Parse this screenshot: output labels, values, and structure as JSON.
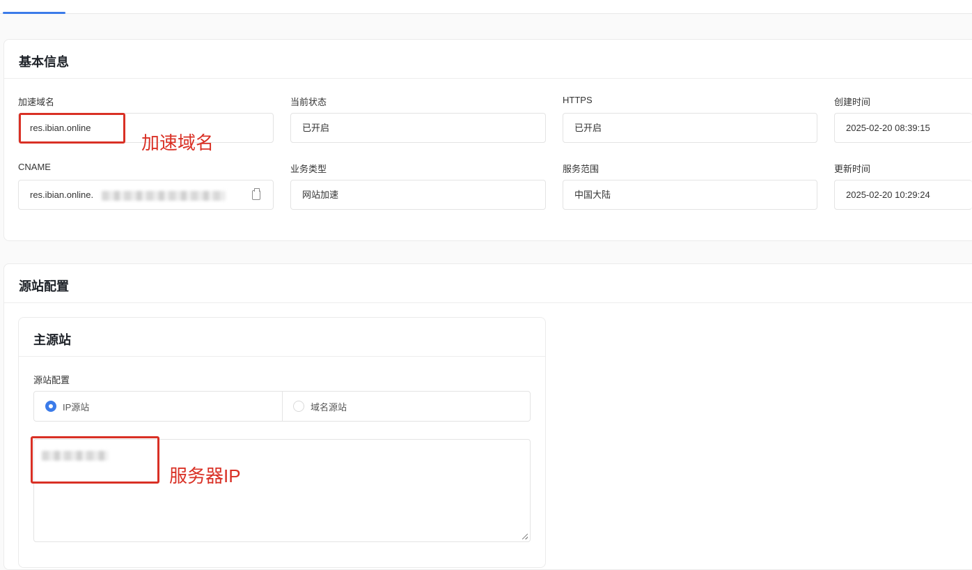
{
  "basic_info": {
    "title": "基本信息",
    "fields": [
      {
        "label": "加速域名",
        "value": "res.ibian.online"
      },
      {
        "label": "当前状态",
        "value": "已开启"
      },
      {
        "label": "HTTPS",
        "value": "已开启"
      },
      {
        "label": "创建时间",
        "value": "2025-02-20 08:39:15"
      },
      {
        "label": "CNAME",
        "value": "res.ibian.online."
      },
      {
        "label": "业务类型",
        "value": "网站加速"
      },
      {
        "label": "服务范围",
        "value": "中国大陆"
      },
      {
        "label": "更新时间",
        "value": "2025-02-20 10:29:24"
      }
    ]
  },
  "origin_config": {
    "title": "源站配置",
    "primary": {
      "title": "主源站",
      "config_label": "源站配置",
      "options": [
        {
          "label": "IP源站",
          "selected": true
        },
        {
          "label": "域名源站",
          "selected": false
        }
      ]
    }
  },
  "annotations": {
    "domain_note": "加速域名",
    "ip_note": "服务器IP",
    "color": "#d93025"
  },
  "colors": {
    "accent": "#3b7be9"
  }
}
